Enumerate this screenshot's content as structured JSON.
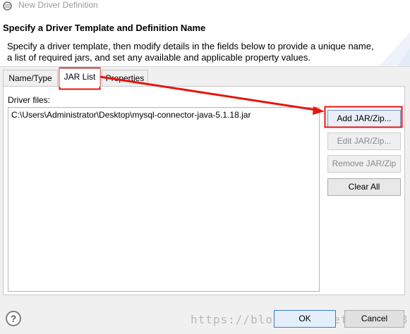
{
  "window": {
    "title": "New Driver Definition"
  },
  "header": {
    "title": "Specify a Driver Template and Definition Name",
    "description": "Specify a driver template, then modify details in the fields below to provide a unique name, a list of required jars, and set any available and applicable property values."
  },
  "tabs": [
    {
      "label": "Name/Type"
    },
    {
      "label": "JAR List",
      "selected": true
    },
    {
      "label": "Properties"
    }
  ],
  "driver_files": {
    "label": "Driver files:",
    "items": [
      "C:\\Users\\Administrator\\Desktop\\mysql-connector-java-5.1.18.jar"
    ]
  },
  "buttons": {
    "add": "Add JAR/Zip...",
    "edit": "Edit JAR/Zip...",
    "remove": "Remove JAR/Zip",
    "clear": "Clear All"
  },
  "footer": {
    "help": "?",
    "ok": "OK",
    "cancel": "Cancel",
    "watermark": "https://blog.csdn.net/li...08"
  },
  "colors": {
    "annotation": "#e8140f",
    "accent": "#3d7bd6"
  }
}
